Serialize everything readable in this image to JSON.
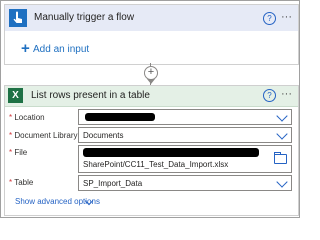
{
  "trigger": {
    "title": "Manually trigger a flow",
    "add_input_label": "Add an input",
    "icon": "hand-touch-icon"
  },
  "action": {
    "title": "List rows present in a table",
    "icon": "excel-icon",
    "fields": {
      "location": {
        "label": "Location",
        "required": "*"
      },
      "document_library": {
        "label": "Document Library",
        "value": "Documents",
        "required": "*"
      },
      "file": {
        "label": "File",
        "value": "SharePoint/CC11_Test_Data_Import.xlsx",
        "required": "*"
      },
      "table": {
        "label": "Table",
        "value": "SP_Import_Data",
        "required": "*"
      }
    },
    "advanced_options_label": "Show advanced options"
  },
  "help_glyph": "?",
  "more_glyph": "···",
  "connector_plus": "+",
  "colors": {
    "trigger_header": "#e6eaf6",
    "trigger_icon": "#1f70c1",
    "excel_header": "#e4f0e6",
    "excel_icon": "#1e7145",
    "link_blue": "#2563c4",
    "required_red": "#d13438"
  }
}
